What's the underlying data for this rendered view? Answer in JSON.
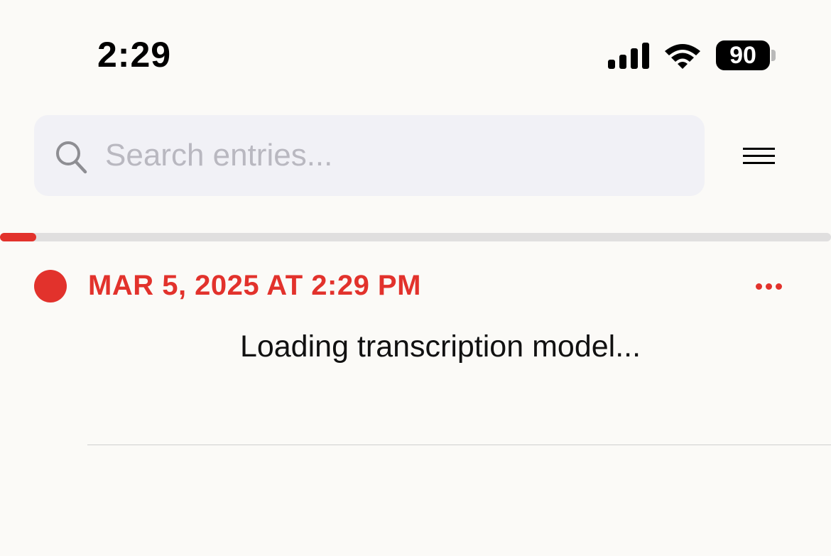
{
  "status_bar": {
    "time": "2:29",
    "battery_level": "90",
    "signal_icon": "cellular-signal-icon",
    "wifi_icon": "wifi-icon"
  },
  "search": {
    "placeholder": "Search entries...",
    "value": "",
    "icon": "search-icon"
  },
  "menu": {
    "icon": "menu-icon"
  },
  "progress": {
    "fraction": 0.044,
    "fill_color": "#e2322c"
  },
  "entry": {
    "date": "MAR 5, 2025 AT 2:29 PM",
    "status_text": "Loading transcription model...",
    "indicator_color": "#e2322c",
    "more_icon": "more-options-icon"
  },
  "colors": {
    "accent": "#e2322c",
    "background": "#fbfaf7",
    "search_background": "#f1f1f6"
  }
}
